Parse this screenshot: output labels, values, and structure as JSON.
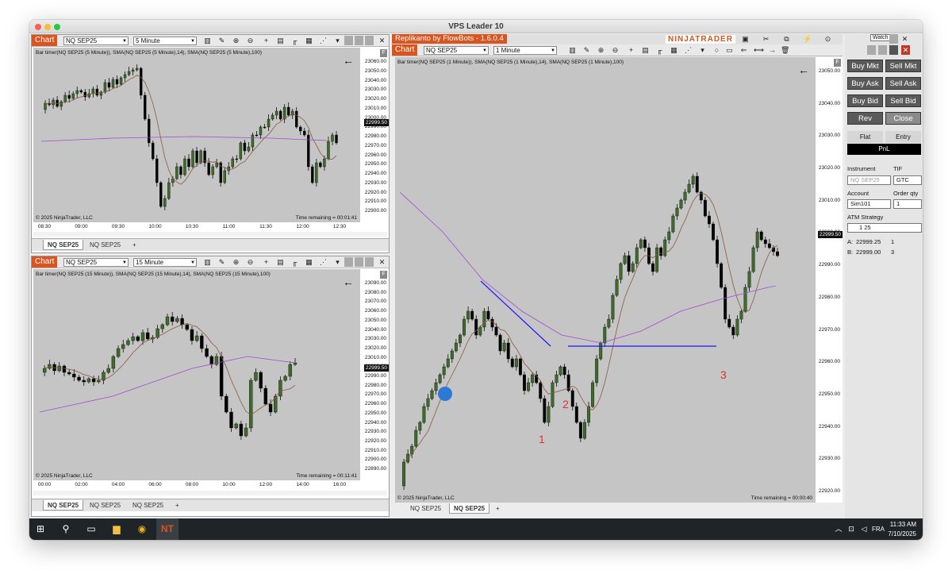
{
  "window": {
    "title": "VPS Leader 10"
  },
  "top_left": {
    "chart_label": "Chart",
    "instrument": "NQ SEP25",
    "interval": "5 Minute",
    "legend": "Bar timer(NQ SEP25 (5 Minute)), SMA(NQ SEP25 (5 Minute),14), SMA(NQ SEP25 (5 Minute),100)",
    "f": "F",
    "copyright": "© 2025 NinjaTrader, LLC",
    "time_remaining": "Time remaining = 00:01:41",
    "price_label": "22999.50",
    "yticks": [
      "23060.00",
      "23050.00",
      "23040.00",
      "23030.00",
      "23020.00",
      "23010.00",
      "23000.00",
      "22990.00",
      "22980.00",
      "22970.00",
      "22960.00",
      "22950.00",
      "22940.00",
      "22930.00",
      "22920.00",
      "22910.00",
      "22900.00"
    ],
    "xticks": [
      "08:30",
      "09:00",
      "09:30",
      "10:00",
      "10:30",
      "11:00",
      "11:30",
      "12:00",
      "12:30"
    ],
    "tabs": [
      "NQ SEP25",
      "NQ SEP25",
      "+"
    ]
  },
  "bottom_left": {
    "chart_label": "Chart",
    "instrument": "NQ SEP25",
    "interval": "15 Minute",
    "legend": "Bar timer(NQ SEP25 (15 Minute)), SMA(NQ SEP25 (15 Minute),14), SMA(NQ SEP25 (15 Minute),100)",
    "f": "F",
    "copyright": "© 2025 NinjaTrader, LLC",
    "time_remaining": "Time remaining = 00:11:41",
    "price_label": "22999.50",
    "yticks": [
      "23090.00",
      "23080.00",
      "23070.00",
      "23060.00",
      "23050.00",
      "23040.00",
      "23030.00",
      "23020.00",
      "23010.00",
      "23000.00",
      "22990.00",
      "22980.00",
      "22970.00",
      "22960.00",
      "22950.00",
      "22940.00",
      "22930.00",
      "22920.00",
      "22910.00",
      "22900.00",
      "22890.00"
    ],
    "xticks": [
      "00:00",
      "02:00",
      "04:00",
      "06:00",
      "08:00",
      "10:00",
      "12:00",
      "14:00",
      "16:00"
    ],
    "tabs": [
      "NQ SEP25",
      "NQ SEP25",
      "NQ SEP25",
      "+"
    ]
  },
  "right": {
    "strategy_title": "Replikanto by FlowBots - 1.6.0.4",
    "brand": "NINJATRADER",
    "watch": "Watch",
    "chart_label": "Chart",
    "instrument": "NQ SEP25",
    "interval": "1 Minute",
    "legend": "Bar timer(NQ SEP25 (1 Minute)), SMA(NQ SEP25 (1 Minute),14), SMA(NQ SEP25 (1 Minute),100)",
    "f": "F",
    "copyright": "© 2025 NinjaTrader, LLC",
    "time_remaining": "Time remaining = 00:00:40",
    "price_label": "22999.50",
    "yticks": [
      "23050.00",
      "23040.00",
      "23030.00",
      "23020.00",
      "23010.00",
      "23000.00",
      "22990.00",
      "22980.00",
      "22970.00",
      "22960.00",
      "22950.00",
      "22940.00",
      "22930.00",
      "22920.00"
    ],
    "xticks": [
      "10:30",
      "10:40",
      "10:50",
      "11:00",
      "11:10",
      "11:20",
      "11:30",
      "11:40",
      "11:50",
      "12:00",
      "12:10",
      "12:20",
      "12:30",
      "12:40"
    ],
    "annotations": [
      "1",
      "2",
      "3"
    ],
    "tabs": [
      "NQ SEP25",
      "NQ SEP25",
      "+"
    ]
  },
  "order_panel": {
    "buy_mkt": "Buy Mkt",
    "sell_mkt": "Sell Mkt",
    "buy_ask": "Buy Ask",
    "sell_ask": "Sell Ask",
    "buy_bid": "Buy Bid",
    "sell_bid": "Sell Bid",
    "rev": "Rev",
    "close": "Close",
    "flat": "Flat",
    "entry": "Entry",
    "pnl": "PnL",
    "instrument_label": "Instrument",
    "instrument_value": "NQ SEP25",
    "tif_label": "TIF",
    "tif_value": "GTC",
    "account_label": "Account",
    "account_value": "Sim101",
    "order_qty_label": "Order qty",
    "order_qty_value": "1",
    "atm_label": "ATM Strategy",
    "atm_value": "1 25",
    "a_label": "A:",
    "a_price": "22999.25",
    "a_qty": "1",
    "b_label": "B:",
    "b_price": "22999.00",
    "b_qty": "3"
  },
  "taskbar": {
    "lang": "FRA",
    "time": "11:33 AM",
    "date": "7/10/2025"
  },
  "colors": {
    "chart_tab": "#d9541e",
    "up_candle": "#3d6b2a",
    "down_candle": "#000000",
    "sma14": "#8b5a3c",
    "sma100": "#a24bd0",
    "trendline": "#1a1aff",
    "annotation": "#e03030"
  }
}
